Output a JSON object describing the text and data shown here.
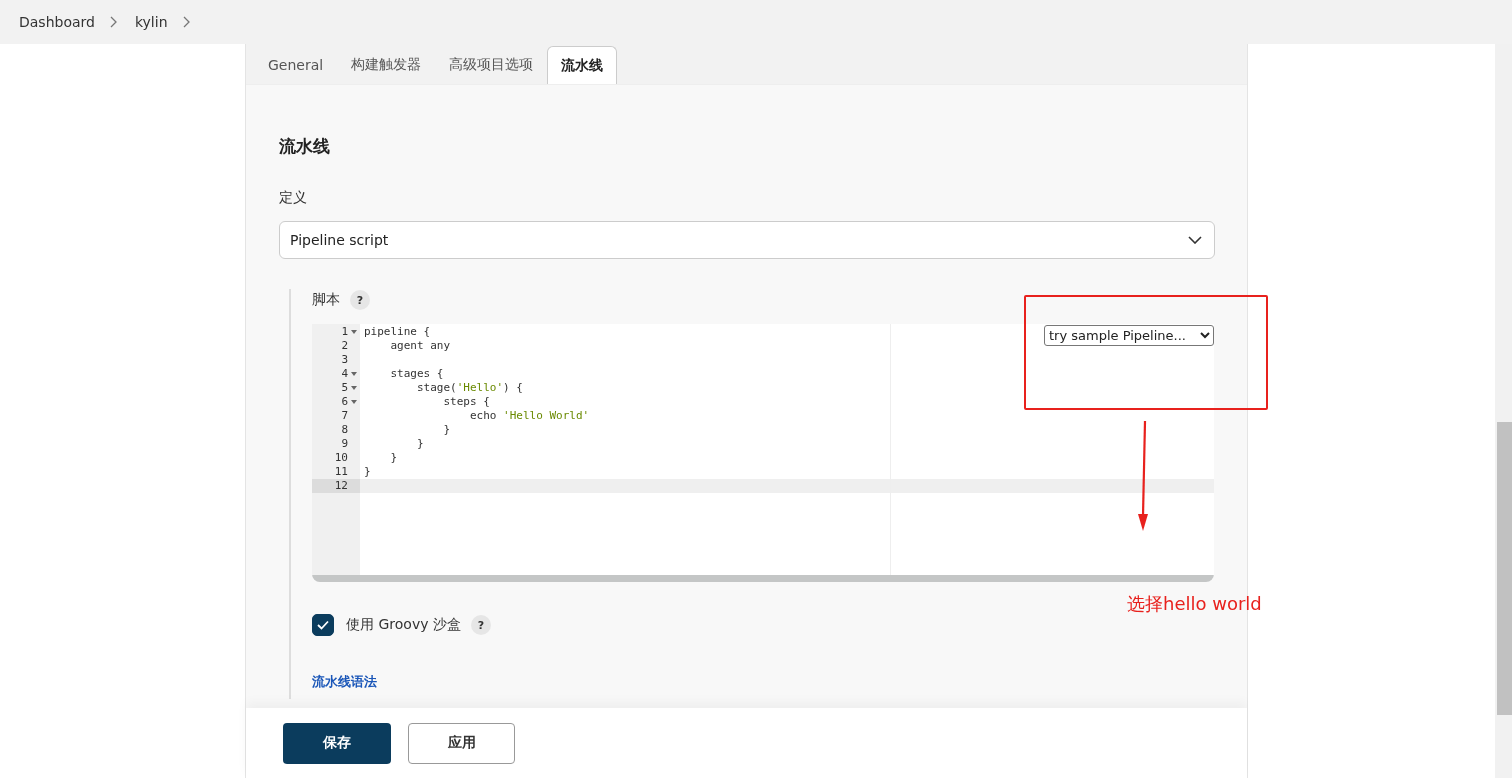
{
  "breadcrumb": [
    "Dashboard",
    "kylin"
  ],
  "tabs": [
    {
      "label": "General",
      "selected": false
    },
    {
      "label": "构建触发器",
      "selected": false
    },
    {
      "label": "高级项目选项",
      "selected": false
    },
    {
      "label": "流水线",
      "selected": true
    }
  ],
  "section_title": "流水线",
  "definition": {
    "label": "定义",
    "value": "Pipeline script"
  },
  "script": {
    "label": "脚本",
    "help": "?",
    "sample_select": "try sample Pipeline...",
    "lines": [
      {
        "number": "1",
        "foldable": true,
        "current": false,
        "parts": [
          {
            "kind": "plain",
            "text": "pipeline {"
          }
        ]
      },
      {
        "number": "2",
        "foldable": false,
        "current": false,
        "parts": [
          {
            "kind": "plain",
            "text": "    agent any"
          }
        ]
      },
      {
        "number": "3",
        "foldable": false,
        "current": false
      },
      {
        "number": "4",
        "foldable": true,
        "current": false,
        "parts": [
          {
            "kind": "plain",
            "text": "    stages {"
          }
        ]
      },
      {
        "number": "5",
        "foldable": true,
        "current": false,
        "parts": [
          {
            "kind": "plain",
            "text": "        stage("
          },
          {
            "kind": "string",
            "text": "'Hello'"
          },
          {
            "kind": "plain",
            "text": ") {"
          }
        ]
      },
      {
        "number": "6",
        "foldable": true,
        "current": false,
        "parts": [
          {
            "kind": "plain",
            "text": "            steps {"
          }
        ]
      },
      {
        "number": "7",
        "foldable": false,
        "current": false,
        "parts": [
          {
            "kind": "plain",
            "text": "                echo "
          },
          {
            "kind": "string",
            "text": "'Hello World'"
          }
        ]
      },
      {
        "number": "8",
        "foldable": false,
        "current": false,
        "parts": [
          {
            "kind": "plain",
            "text": "            }"
          }
        ]
      },
      {
        "number": "9",
        "foldable": false,
        "current": false,
        "parts": [
          {
            "kind": "plain",
            "text": "        }"
          }
        ]
      },
      {
        "number": "10",
        "foldable": false,
        "current": false,
        "parts": [
          {
            "kind": "plain",
            "text": "    }"
          }
        ]
      },
      {
        "number": "11",
        "foldable": false,
        "current": false,
        "parts": [
          {
            "kind": "plain",
            "text": "}"
          }
        ]
      },
      {
        "number": "12",
        "foldable": false,
        "current": true
      }
    ]
  },
  "sandbox": {
    "label": "使用 Groovy 沙盒",
    "checked": true,
    "help": "?"
  },
  "syntax_link": "流水线语法",
  "buttons": [
    {
      "label": "保存",
      "kind": "primary"
    },
    {
      "label": "应用",
      "kind": "secondary"
    }
  ],
  "annotation": {
    "text": "选择hello world"
  }
}
